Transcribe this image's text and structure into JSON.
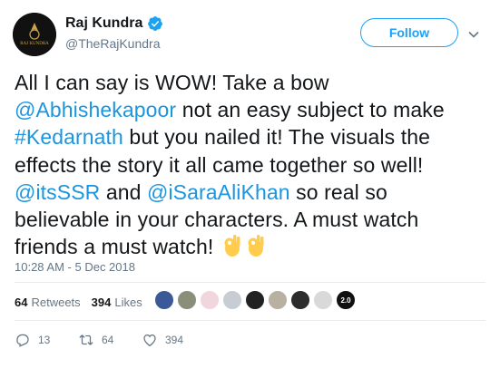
{
  "user": {
    "display_name": "Raj Kundra",
    "handle": "@TheRajKundra",
    "avatar_text": "RAJ KUNDRA",
    "verified": true
  },
  "follow_label": "Follow",
  "tweet": {
    "t1": "All I can say is WOW! Take a bow ",
    "m1": "@Abhishekapoor",
    "t2": " not an easy subject to make ",
    "h1": "#Kedarnath",
    "t3": " but you nailed it! The visuals the effects the story it all came together so well! ",
    "m2": "@itsSSR",
    "t4": " and ",
    "m3": "@iSaraAliKhan",
    "t5": " so real so believable in your characters. A must watch friends a must watch! ",
    "emoji": "ok-hand-emoji x2"
  },
  "timestamp": "10:28 AM - 5 Dec 2018",
  "stats": {
    "retweets_count": "64",
    "retweets_label": "Retweets",
    "likes_count": "394",
    "likes_label": "Likes"
  },
  "liker_avatar_colors": [
    "#3b5998",
    "#8a8f7a",
    "#f1d6de",
    "#c7cdd3",
    "#222222",
    "#b8b0a0",
    "#2c2c2c",
    "#d9d9d9",
    "#111111"
  ],
  "liker_last_label": "2.0",
  "actions": {
    "reply_count": "13",
    "retweet_count": "64",
    "like_count": "394"
  },
  "colors": {
    "link": "#1b95e0",
    "accent": "#1da1f2",
    "muted": "#657786"
  }
}
